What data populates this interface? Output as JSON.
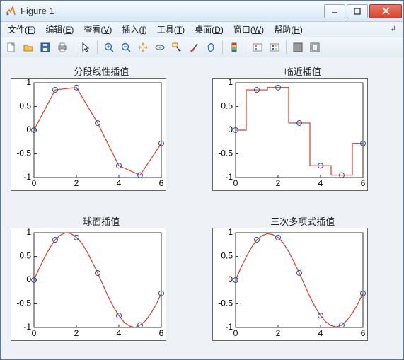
{
  "window": {
    "title": "Figure 1"
  },
  "menus": {
    "file": {
      "label": "文件",
      "accel": "F"
    },
    "edit": {
      "label": "编辑",
      "accel": "E"
    },
    "view": {
      "label": "查看",
      "accel": "V"
    },
    "insert": {
      "label": "插入",
      "accel": "I"
    },
    "tools": {
      "label": "工具",
      "accel": "T"
    },
    "desktop": {
      "label": "桌面",
      "accel": "D"
    },
    "window": {
      "label": "窗口",
      "accel": "W"
    },
    "help": {
      "label": "帮助",
      "accel": "H"
    }
  },
  "toolbar_icons": [
    "new-file-icon",
    "open-file-icon",
    "save-icon",
    "print-icon",
    "sep",
    "pointer-icon",
    "sep",
    "zoom-in-icon",
    "zoom-out-icon",
    "pan-icon",
    "rotate3d-icon",
    "data-cursor-icon",
    "brush-icon",
    "link-icon",
    "sep",
    "colorbar-icon",
    "sep",
    "legend-insert-icon",
    "legend-edit-icon",
    "sep",
    "dock-icon",
    "undock-icon"
  ],
  "chart_data": [
    {
      "type": "line",
      "title": "分段线性插值",
      "xlabel": "",
      "ylabel": "",
      "xlim": [
        0,
        6
      ],
      "ylim": [
        -1,
        1
      ],
      "xticks": [
        0,
        2,
        4,
        6
      ],
      "yticks": [
        -1,
        -0.5,
        0,
        0.5,
        1
      ],
      "markers_x": [
        0,
        1,
        2,
        3,
        4,
        5,
        6
      ],
      "markers_y": [
        0.0,
        0.85,
        0.9,
        0.15,
        -0.75,
        -0.95,
        -0.28
      ],
      "segments": [
        [
          [
            0,
            0.0
          ],
          [
            1,
            0.85
          ],
          [
            2,
            0.9
          ],
          [
            3,
            0.15
          ],
          [
            4,
            -0.75
          ],
          [
            5,
            -0.95
          ],
          [
            6,
            -0.28
          ]
        ]
      ]
    },
    {
      "type": "line",
      "title": "临近插值",
      "xlabel": "",
      "ylabel": "",
      "xlim": [
        0,
        6
      ],
      "ylim": [
        -1,
        1
      ],
      "xticks": [
        0,
        2,
        4,
        6
      ],
      "yticks": [
        -1,
        -0.5,
        0,
        0.5,
        1
      ],
      "markers_x": [
        0,
        1,
        2,
        3,
        4,
        5,
        6
      ],
      "markers_y": [
        0.0,
        0.85,
        0.9,
        0.15,
        -0.75,
        -0.95,
        -0.28
      ],
      "segments": [
        [
          [
            0,
            0.0
          ],
          [
            0.5,
            0.0
          ],
          [
            0.5,
            0.85
          ],
          [
            1.5,
            0.85
          ],
          [
            1.5,
            0.9
          ],
          [
            2.5,
            0.9
          ],
          [
            2.5,
            0.15
          ],
          [
            3.5,
            0.15
          ],
          [
            3.5,
            -0.75
          ],
          [
            4.5,
            -0.75
          ],
          [
            4.5,
            -0.95
          ],
          [
            5.5,
            -0.95
          ],
          [
            5.5,
            -0.28
          ],
          [
            6,
            -0.28
          ]
        ]
      ]
    },
    {
      "type": "line",
      "title": "球面插值",
      "xlabel": "",
      "ylabel": "",
      "xlim": [
        0,
        6
      ],
      "ylim": [
        -1,
        1
      ],
      "xticks": [
        0,
        2,
        4,
        6
      ],
      "yticks": [
        -1,
        -0.5,
        0,
        0.5,
        1
      ],
      "markers_x": [
        0,
        1,
        2,
        3,
        4,
        5,
        6
      ],
      "markers_y": [
        0.0,
        0.85,
        0.9,
        0.15,
        -0.75,
        -0.95,
        -0.28
      ],
      "segments": [
        [
          [
            0,
            0.0
          ],
          [
            0.25,
            0.25
          ],
          [
            0.5,
            0.48
          ],
          [
            0.75,
            0.68
          ],
          [
            1,
            0.85
          ],
          [
            1.25,
            0.95
          ],
          [
            1.5,
            1.0
          ],
          [
            1.75,
            0.98
          ],
          [
            2,
            0.9
          ],
          [
            2.25,
            0.78
          ],
          [
            2.5,
            0.6
          ],
          [
            2.75,
            0.38
          ],
          [
            3,
            0.15
          ],
          [
            3.25,
            -0.1
          ],
          [
            3.5,
            -0.35
          ],
          [
            3.75,
            -0.57
          ],
          [
            4,
            -0.75
          ],
          [
            4.25,
            -0.89
          ],
          [
            4.5,
            -0.97
          ],
          [
            4.75,
            -1.0
          ],
          [
            5,
            -0.95
          ],
          [
            5.25,
            -0.86
          ],
          [
            5.5,
            -0.71
          ],
          [
            5.75,
            -0.52
          ],
          [
            6,
            -0.28
          ]
        ]
      ]
    },
    {
      "type": "line",
      "title": "三次多项式插值",
      "xlabel": "",
      "ylabel": "",
      "xlim": [
        0,
        6
      ],
      "ylim": [
        -1,
        1
      ],
      "xticks": [
        0,
        2,
        4,
        6
      ],
      "yticks": [
        -1,
        -0.5,
        0,
        0.5,
        1
      ],
      "markers_x": [
        0,
        1,
        2,
        3,
        4,
        5,
        6
      ],
      "markers_y": [
        0.0,
        0.85,
        0.9,
        0.15,
        -0.75,
        -0.95,
        -0.28
      ],
      "segments": [
        [
          [
            0,
            0.0
          ],
          [
            0.25,
            0.26
          ],
          [
            0.5,
            0.49
          ],
          [
            0.75,
            0.69
          ],
          [
            1,
            0.85
          ],
          [
            1.25,
            0.94
          ],
          [
            1.5,
            0.98
          ],
          [
            1.75,
            0.96
          ],
          [
            2,
            0.9
          ],
          [
            2.25,
            0.78
          ],
          [
            2.5,
            0.6
          ],
          [
            2.75,
            0.38
          ],
          [
            3,
            0.15
          ],
          [
            3.25,
            -0.1
          ],
          [
            3.5,
            -0.35
          ],
          [
            3.75,
            -0.57
          ],
          [
            4,
            -0.75
          ],
          [
            4.25,
            -0.88
          ],
          [
            4.5,
            -0.96
          ],
          [
            4.75,
            -0.99
          ],
          [
            5,
            -0.95
          ],
          [
            5.25,
            -0.85
          ],
          [
            5.5,
            -0.7
          ],
          [
            5.75,
            -0.51
          ],
          [
            6,
            -0.28
          ]
        ]
      ]
    }
  ]
}
